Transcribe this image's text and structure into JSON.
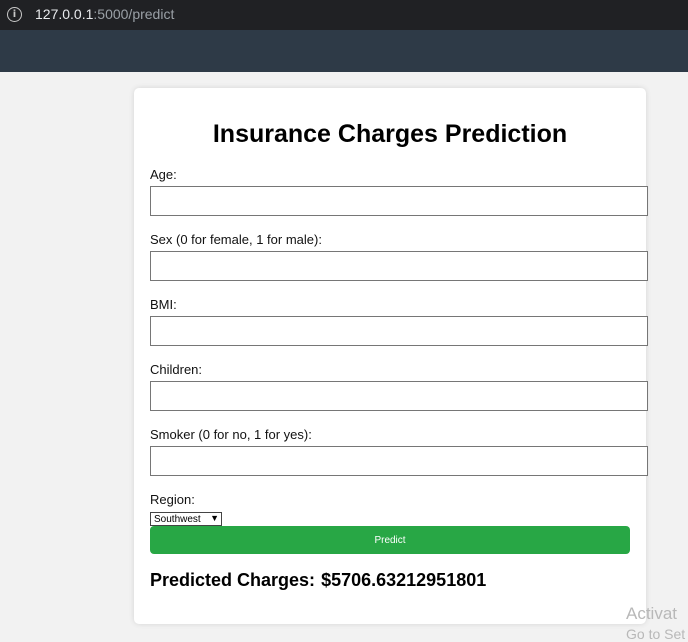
{
  "browser": {
    "url_host": "127.0.0.1",
    "url_path": ":5000/predict"
  },
  "form": {
    "title": "Insurance Charges Prediction",
    "fields": [
      {
        "label": "Age:",
        "value": ""
      },
      {
        "label": "Sex (0 for female, 1 for male):",
        "value": ""
      },
      {
        "label": "BMI:",
        "value": ""
      },
      {
        "label": "Children:",
        "value": ""
      },
      {
        "label": "Smoker (0 for no, 1 for yes):",
        "value": ""
      }
    ],
    "region_label": "Region:",
    "region_selected": "Southwest",
    "predict_label": "Predict"
  },
  "result": {
    "label": "Predicted Charges:",
    "value": "$5706.63212951801"
  },
  "watermark": {
    "line1": "Activat",
    "line2": "Go to Set"
  },
  "colors": {
    "accent": "#28a745",
    "header": "#2e3a47",
    "browser_bar": "#202124"
  }
}
